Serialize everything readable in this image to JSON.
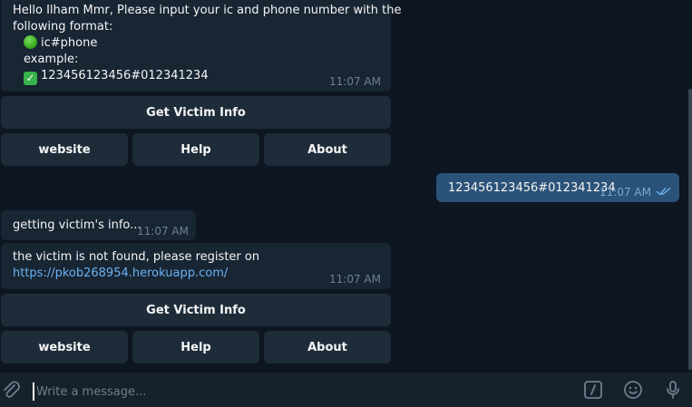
{
  "messages": {
    "intro": {
      "line1": "Hello Ilham Mmr, Please input your ic and phone number with the",
      "line2": "following format:",
      "format": "ic#phone",
      "example_label": "example:",
      "example_value": "123456123456#012341234",
      "time": "11:07 AM"
    },
    "user": {
      "text": "123456123456#012341234",
      "time": "11:07 AM"
    },
    "getting": {
      "text": "getting victim's info...",
      "time": "11:07 AM"
    },
    "notfound": {
      "text": "the victim is not found, please register on",
      "link": "https://pkob268954.herokuapp.com/",
      "time": "11:07 AM"
    }
  },
  "keyboard": {
    "get_info": "Get Victim Info",
    "website": "website",
    "help": "Help",
    "about": "About"
  },
  "composer": {
    "placeholder": "Write a message..."
  },
  "icons": {
    "attach": "paperclip-icon",
    "commands": "slash-commands-icon",
    "emoji": "smiley-icon",
    "mic": "microphone-icon",
    "read": "double-check-icon"
  },
  "colors": {
    "background": "#0e1621",
    "incoming_bubble": "#182533",
    "outgoing_bubble": "#2b5278",
    "link": "#6ab2f2",
    "timestamp": "#6d7f8f"
  }
}
